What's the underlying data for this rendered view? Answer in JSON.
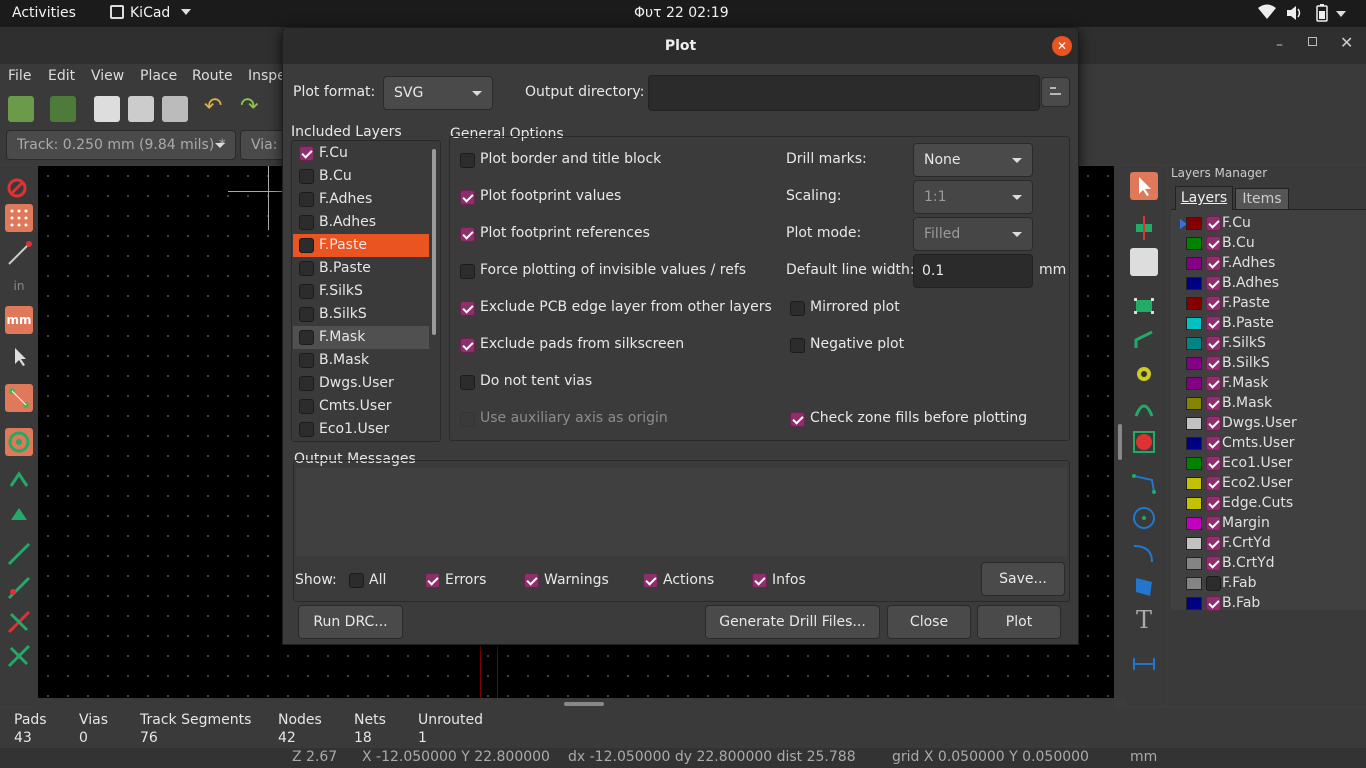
{
  "topbar": {
    "activities": "Activities",
    "app": "KiCad",
    "clock": "Φυτ 22  02:19"
  },
  "menu": [
    "File",
    "Edit",
    "View",
    "Place",
    "Route",
    "Inspe"
  ],
  "optbar": {
    "track": "Track: 0.250 mm (9.84 mils) *",
    "via": "Via:"
  },
  "dialog": {
    "title": "Plot",
    "plot_format_label": "Plot format:",
    "plot_format_value": "SVG",
    "output_dir_label": "Output directory:",
    "output_dir_value": "",
    "included_layers_title": "Included Layers",
    "layers": [
      {
        "name": "F.Cu",
        "checked": true
      },
      {
        "name": "B.Cu",
        "checked": false
      },
      {
        "name": "F.Adhes",
        "checked": false
      },
      {
        "name": "B.Adhes",
        "checked": false
      },
      {
        "name": "F.Paste",
        "checked": false
      },
      {
        "name": "B.Paste",
        "checked": false
      },
      {
        "name": "F.SilkS",
        "checked": false
      },
      {
        "name": "B.SilkS",
        "checked": false
      },
      {
        "name": "F.Mask",
        "checked": false
      },
      {
        "name": "B.Mask",
        "checked": false
      },
      {
        "name": "Dwgs.User",
        "checked": false
      },
      {
        "name": "Cmts.User",
        "checked": false
      },
      {
        "name": "Eco1.User",
        "checked": false
      }
    ],
    "general_options_title": "General Options",
    "options": {
      "plot_border": "Plot border and title block",
      "footprint_values": "Plot footprint values",
      "footprint_refs": "Plot footprint references",
      "force_invisible": "Force plotting of invisible values / refs",
      "exclude_edge": "Exclude PCB edge layer from other layers",
      "exclude_pads": "Exclude pads from silkscreen",
      "no_tent": "Do not tent vias",
      "aux_axis": "Use auxiliary axis as origin",
      "mirrored": "Mirrored plot",
      "negative": "Negative plot",
      "check_zone": "Check zone fills before plotting"
    },
    "drill_marks_label": "Drill marks:",
    "drill_marks_value": "None",
    "scaling_label": "Scaling:",
    "scaling_value": "1:1",
    "plot_mode_label": "Plot mode:",
    "plot_mode_value": "Filled",
    "line_width_label": "Default line width:",
    "line_width_value": "0.1",
    "line_width_unit": "mm",
    "output_messages_title": "Output Messages",
    "show_label": "Show:",
    "filters": {
      "all": "All",
      "errors": "Errors",
      "warnings": "Warnings",
      "actions": "Actions",
      "infos": "Infos"
    },
    "save_btn": "Save...",
    "run_drc_btn": "Run DRC...",
    "drill_files_btn": "Generate Drill Files...",
    "close_btn": "Close",
    "plot_btn": "Plot"
  },
  "layers_manager": {
    "title": "Layers Manager",
    "tabs": [
      "Layers",
      "Items"
    ],
    "layers": [
      {
        "name": "F.Cu",
        "color": "#840000",
        "checked": true
      },
      {
        "name": "B.Cu",
        "color": "#008400",
        "checked": true
      },
      {
        "name": "F.Adhes",
        "color": "#840084",
        "checked": true
      },
      {
        "name": "B.Adhes",
        "color": "#000084",
        "checked": true
      },
      {
        "name": "F.Paste",
        "color": "#840000",
        "checked": true
      },
      {
        "name": "B.Paste",
        "color": "#00c2c2",
        "checked": true
      },
      {
        "name": "F.SilkS",
        "color": "#008484",
        "checked": true
      },
      {
        "name": "B.SilkS",
        "color": "#840084",
        "checked": true
      },
      {
        "name": "F.Mask",
        "color": "#840084",
        "checked": true
      },
      {
        "name": "B.Mask",
        "color": "#848400",
        "checked": true
      },
      {
        "name": "Dwgs.User",
        "color": "#c2c2c2",
        "checked": true
      },
      {
        "name": "Cmts.User",
        "color": "#000084",
        "checked": true
      },
      {
        "name": "Eco1.User",
        "color": "#008400",
        "checked": true
      },
      {
        "name": "Eco2.User",
        "color": "#c2c200",
        "checked": true
      },
      {
        "name": "Edge.Cuts",
        "color": "#c2c200",
        "checked": true
      },
      {
        "name": "Margin",
        "color": "#c200c2",
        "checked": true
      },
      {
        "name": "F.CrtYd",
        "color": "#c2c2c2",
        "checked": true
      },
      {
        "name": "B.CrtYd",
        "color": "#848484",
        "checked": true
      },
      {
        "name": "F.Fab",
        "color": "#848484",
        "checked": false
      },
      {
        "name": "B.Fab",
        "color": "#000084",
        "checked": true
      }
    ]
  },
  "status": {
    "headers": [
      "Pads",
      "Vias",
      "Track Segments",
      "Nodes",
      "Nets",
      "Unrouted"
    ],
    "values": [
      "43",
      "0",
      "76",
      "42",
      "18",
      "1"
    ],
    "zoom": "Z 2.67",
    "xy": "X -12.050000  Y 22.800000",
    "delta": "dx -12.050000  dy 22.800000  dist 25.788",
    "grid": "grid X 0.050000  Y 0.050000",
    "units": "mm"
  }
}
